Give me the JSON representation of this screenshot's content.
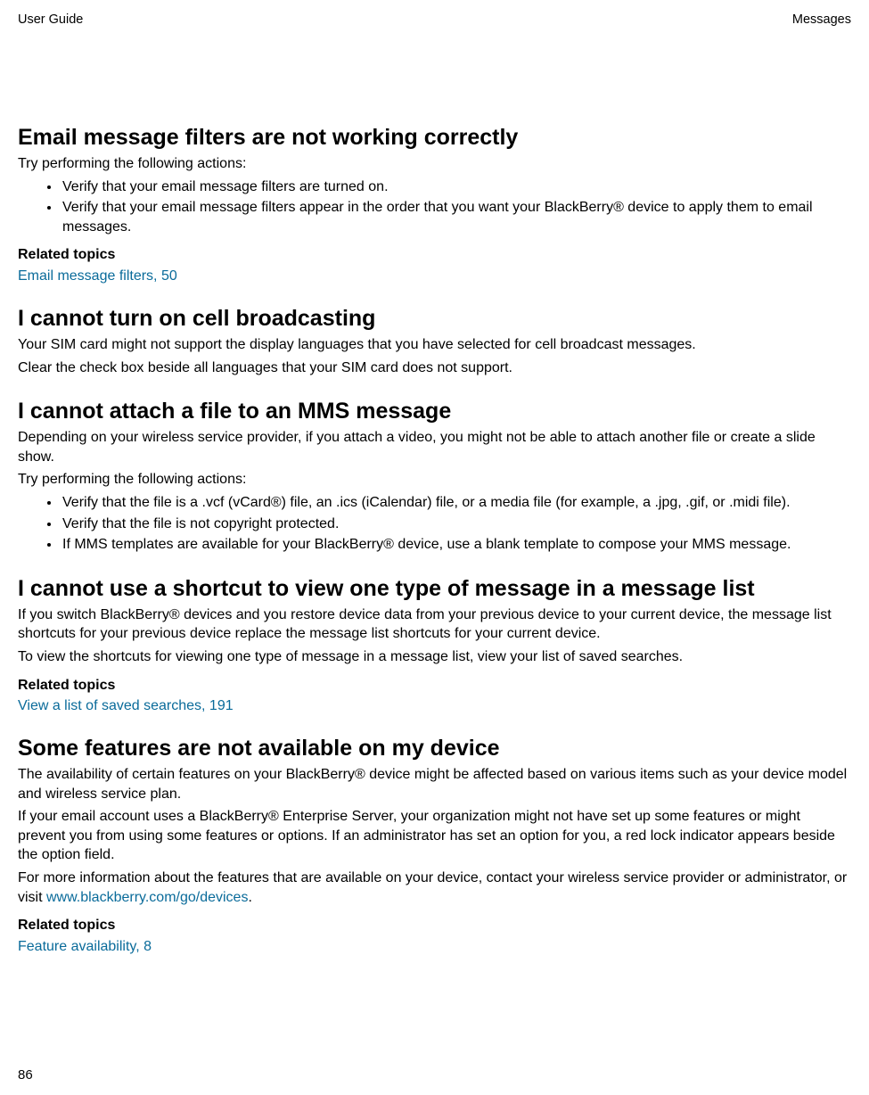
{
  "header": {
    "left": "User Guide",
    "right": "Messages"
  },
  "page_number": "86",
  "sections": {
    "s1": {
      "title": "Email message filters are not working correctly",
      "p1": "Try performing the following actions:",
      "b1": "Verify that your email message filters are turned on.",
      "b2": "Verify that your email message filters appear in the order that you want your BlackBerry® device to apply them to email messages.",
      "related_label": "Related topics",
      "related_link": "Email message filters, 50"
    },
    "s2": {
      "title": "I cannot turn on cell broadcasting",
      "p1": "Your SIM card might not support the display languages that you have selected for cell broadcast messages.",
      "p2": "Clear the check box beside all languages that your SIM card does not support."
    },
    "s3": {
      "title": "I cannot attach a file to an MMS message",
      "p1": "Depending on your wireless service provider, if you attach a video, you might not be able to attach another file or create a slide show.",
      "p2": "Try performing the following actions:",
      "b1": "Verify that the file is a .vcf (vCard®) file, an .ics (iCalendar) file, or a media file (for example, a .jpg, .gif, or .midi file).",
      "b2": "Verify that the file is not copyright protected.",
      "b3": "If MMS templates are available for your BlackBerry® device, use a blank template to compose your MMS message."
    },
    "s4": {
      "title": "I cannot use a shortcut to view one type of message in a message list",
      "p1": "If you switch BlackBerry® devices and you restore device data from your previous device to your current device, the message list shortcuts for your previous device replace the message list shortcuts for your current device.",
      "p2": "To view the shortcuts for viewing one type of message in a message list, view your list of saved searches.",
      "related_label": "Related topics",
      "related_link": "View a list of saved searches, 191"
    },
    "s5": {
      "title": "Some features are not available on my device",
      "p1": "The availability of certain features on your BlackBerry® device might be affected based on various items such as your device model and wireless service plan.",
      "p2": "If your email account uses a BlackBerry® Enterprise Server, your organization might not have set up some features or might prevent you from using some features or options. If an administrator has set an option for you, a red lock indicator appears beside the option field.",
      "p3_a": "For more information about the features that are available on your device, contact your wireless service provider or administrator, or visit ",
      "p3_link": "www.blackberry.com/go/devices",
      "p3_b": ".",
      "related_label": "Related topics",
      "related_link": "Feature availability, 8"
    }
  }
}
